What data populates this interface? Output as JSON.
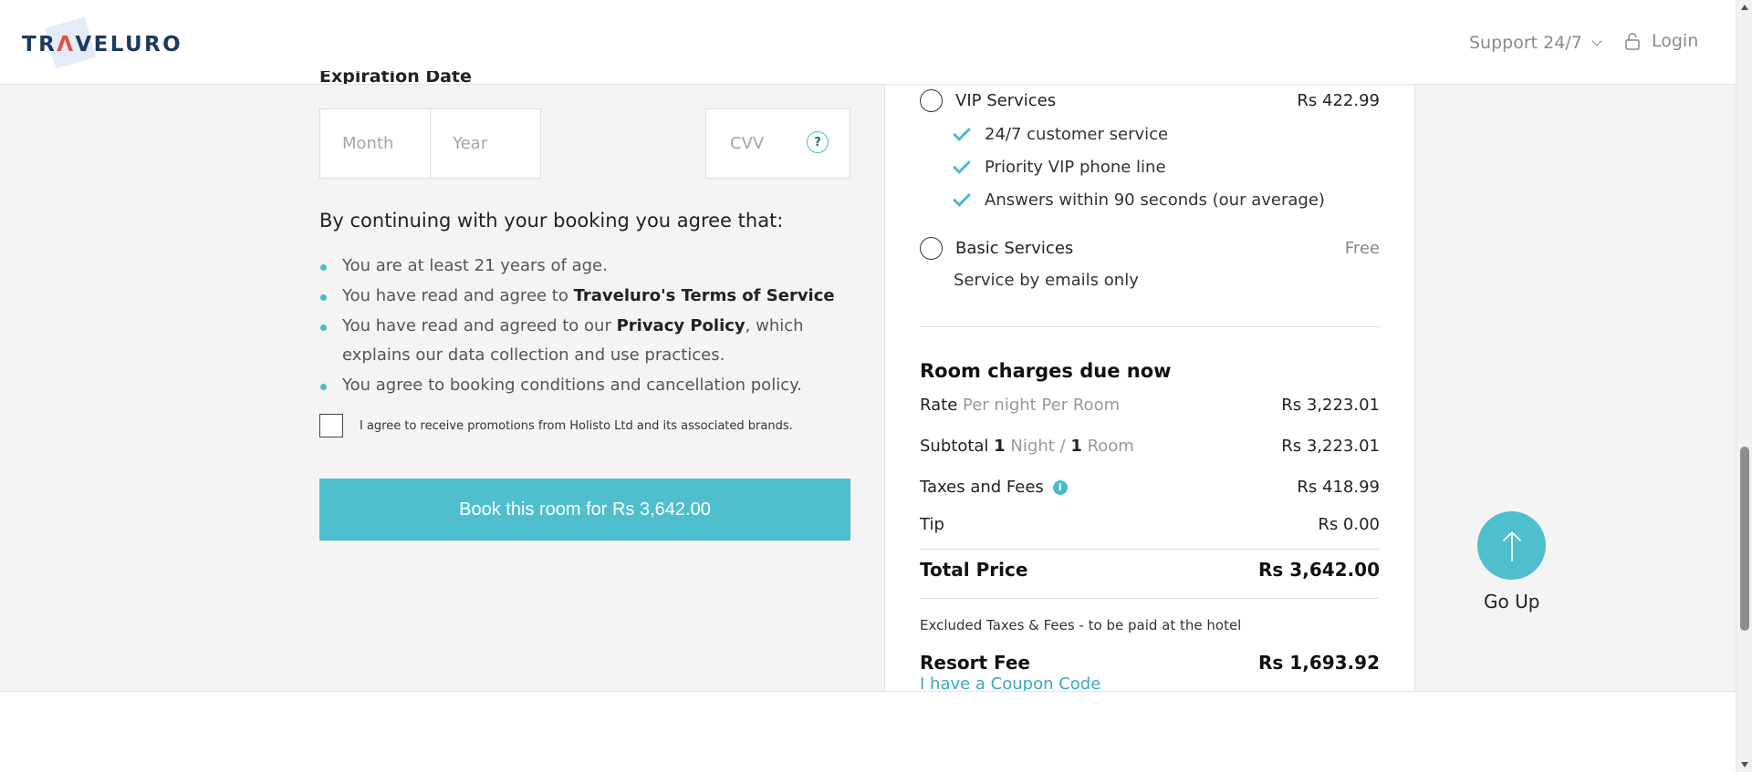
{
  "header": {
    "logo_text_1": "TR",
    "logo_accent": "Λ",
    "logo_text_2": "VELURO",
    "support_label": "Support 24/7",
    "login_label": "Login"
  },
  "payment": {
    "expiration_label": "Expiration Date",
    "month_placeholder": "Month",
    "year_placeholder": "Year",
    "cvv_placeholder": "CVV",
    "cvv_help": "?"
  },
  "agreement": {
    "title": "By continuing with your booking you agree that:",
    "item1": "You are at least 21 years of age.",
    "item2_prefix": "You have read and agree to ",
    "item2_bold": "Traveluro's Terms of Service",
    "item3_prefix": "You have read and agreed to our ",
    "item3_bold": "Privacy Policy",
    "item3_suffix": ", which explains our data collection and use practices.",
    "item4": "You agree to booking conditions and cancellation policy.",
    "promo_text": "I agree to receive promotions from Holisto Ltd and its associated brands."
  },
  "book_button": "Book this room for Rs 3,642.00",
  "services": {
    "vip_label": "VIP Services",
    "vip_price": "Rs 422.99",
    "vip_features": [
      "24/7 customer service",
      "Priority VIP phone line",
      "Answers within 90 seconds (our average)"
    ],
    "basic_label": "Basic Services",
    "basic_price": "Free",
    "basic_note": "Service by emails only"
  },
  "charges": {
    "title": "Room charges due now",
    "rate_label": "Rate",
    "rate_sub": "Per night Per Room",
    "rate_value": "Rs 3,223.01",
    "subtotal_label": "Subtotal",
    "subtotal_nights": "1",
    "subtotal_night_word": "Night /",
    "subtotal_rooms": "1",
    "subtotal_room_word": "Room",
    "subtotal_value": "Rs 3,223.01",
    "taxes_label": "Taxes and Fees",
    "taxes_value": "Rs 418.99",
    "tip_label": "Tip",
    "tip_value": "Rs 0.00",
    "total_label": "Total Price",
    "total_value": "Rs 3,642.00",
    "excluded_note": "Excluded Taxes & Fees - to be paid at the hotel",
    "resort_label": "Resort Fee",
    "resort_value": "Rs 1,693.92",
    "coupon_link": "I have a Coupon Code"
  },
  "go_up_label": "Go Up",
  "colors": {
    "accent": "#4fbfcd",
    "brand_navy": "#1d3a5c",
    "brand_red": "#e0523c"
  }
}
